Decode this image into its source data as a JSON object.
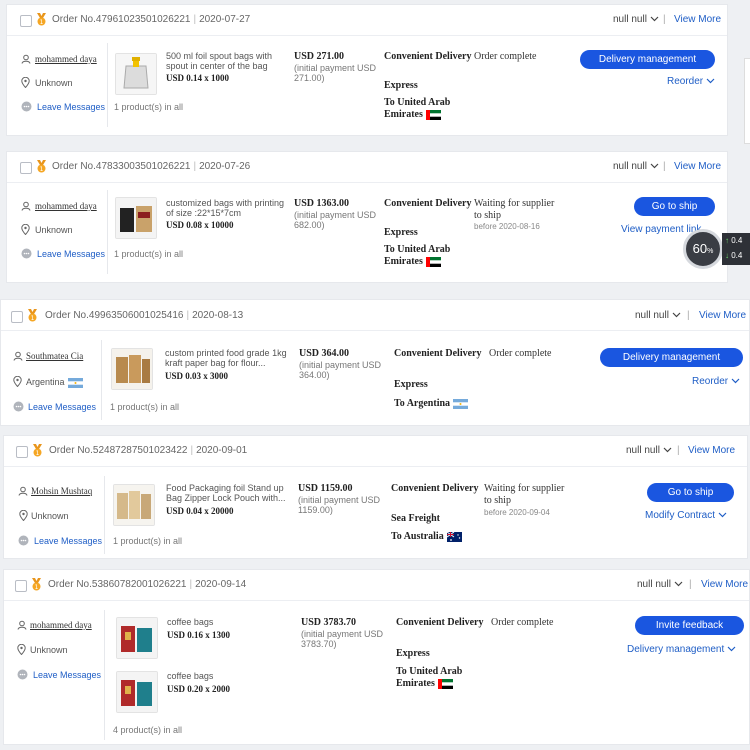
{
  "header_common": {
    "null_select": "null null",
    "view_more": "View More",
    "leave_messages": "Leave Messages",
    "initial_payment_prefix": "(initial payment "
  },
  "orders": [
    {
      "order_no": "Order No.47961023501026221",
      "date": "2020-07-27",
      "buyer": "mohammed daya",
      "location": "Unknown",
      "products": [
        {
          "name": "500 ml foil spout bags with spout in center of the bag",
          "price": "USD 0.14 x 1000"
        }
      ],
      "product_count": "1 product(s) in all",
      "total": "USD 271.00",
      "initial_payment": "(initial payment USD 271.00)",
      "ship_line1": "Convenient Delivery",
      "ship_line2": "Express",
      "destination": "To United Arab Emirates",
      "flag": "uae",
      "status": "Order complete",
      "before": "",
      "primary_button": "Delivery management",
      "secondary_link": "Reorder"
    },
    {
      "order_no": "Order No.47833003501026221",
      "date": "2020-07-26",
      "buyer": "mohammed daya",
      "location": "Unknown",
      "products": [
        {
          "name": "customized bags with printing of size :22*15*7cm",
          "price": "USD 0.08 x 10000"
        }
      ],
      "product_count": "1 product(s) in all",
      "total": "USD 1363.00",
      "initial_payment": "(initial payment USD 682.00)",
      "ship_line1": "Convenient Delivery",
      "ship_line2": "Express",
      "destination": "To United Arab Emirates",
      "flag": "uae",
      "status": "Waiting for supplier to ship",
      "before": "before 2020-08-16",
      "primary_button": "Go to ship",
      "secondary_link": "View payment link"
    },
    {
      "order_no": "Order No.49963506001025416",
      "date": "2020-08-13",
      "buyer": "Southmatea Cia",
      "location": "Argentina",
      "products": [
        {
          "name": "custom printed food grade 1kg kraft paper bag for flour...",
          "price": "USD 0.03 x 3000"
        }
      ],
      "product_count": "1 product(s) in all",
      "total": "USD 364.00",
      "initial_payment": "(initial payment USD 364.00)",
      "ship_line1": "Convenient Delivery",
      "ship_line2": "Express",
      "destination": "To Argentina",
      "flag": "argentina",
      "status": "Order complete",
      "before": "",
      "primary_button": "Delivery management",
      "secondary_link": "Reorder"
    },
    {
      "order_no": "Order No.52487287501023422",
      "date": "2020-09-01",
      "buyer": "Mohsin Mushtaq",
      "location": "Unknown",
      "products": [
        {
          "name": "Food Packaging foil Stand up Bag Zipper Lock Pouch with...",
          "price": "USD 0.04 x 20000"
        }
      ],
      "product_count": "1 product(s) in all",
      "total": "USD 1159.00",
      "initial_payment": "(initial payment USD 1159.00)",
      "ship_line1": "Convenient Delivery",
      "ship_line2": "Sea Freight",
      "destination": "To Australia",
      "flag": "australia",
      "status": "Waiting for supplier to ship",
      "before": "before 2020-09-04",
      "primary_button": "Go to ship",
      "secondary_link": "Modify Contract"
    },
    {
      "order_no": "Order No.53860782001026221",
      "date": "2020-09-14",
      "buyer": "mohammed daya",
      "location": "Unknown",
      "products": [
        {
          "name": "coffee bags",
          "price": "USD 0.16 x 1300"
        },
        {
          "name": "coffee bags",
          "price": "USD 0.20 x 2000"
        }
      ],
      "product_count": "4 product(s) in all",
      "total": "USD 3783.70",
      "initial_payment": "(initial payment USD 3783.70)",
      "ship_line1": "Convenient Delivery",
      "ship_line2": "Express",
      "destination": "To United Arab Emirates",
      "flag": "uae",
      "status": "Order complete",
      "before": "",
      "primary_button": "Invite feedback",
      "secondary_link": "Delivery management"
    }
  ],
  "overlay": {
    "timer": "60",
    "speed_up": "0.4",
    "speed_down": "0.4"
  },
  "colors": {
    "accent_blue": "#1a56e0",
    "link_blue": "#1f5ec6",
    "medal_orange": "#f5a623"
  }
}
